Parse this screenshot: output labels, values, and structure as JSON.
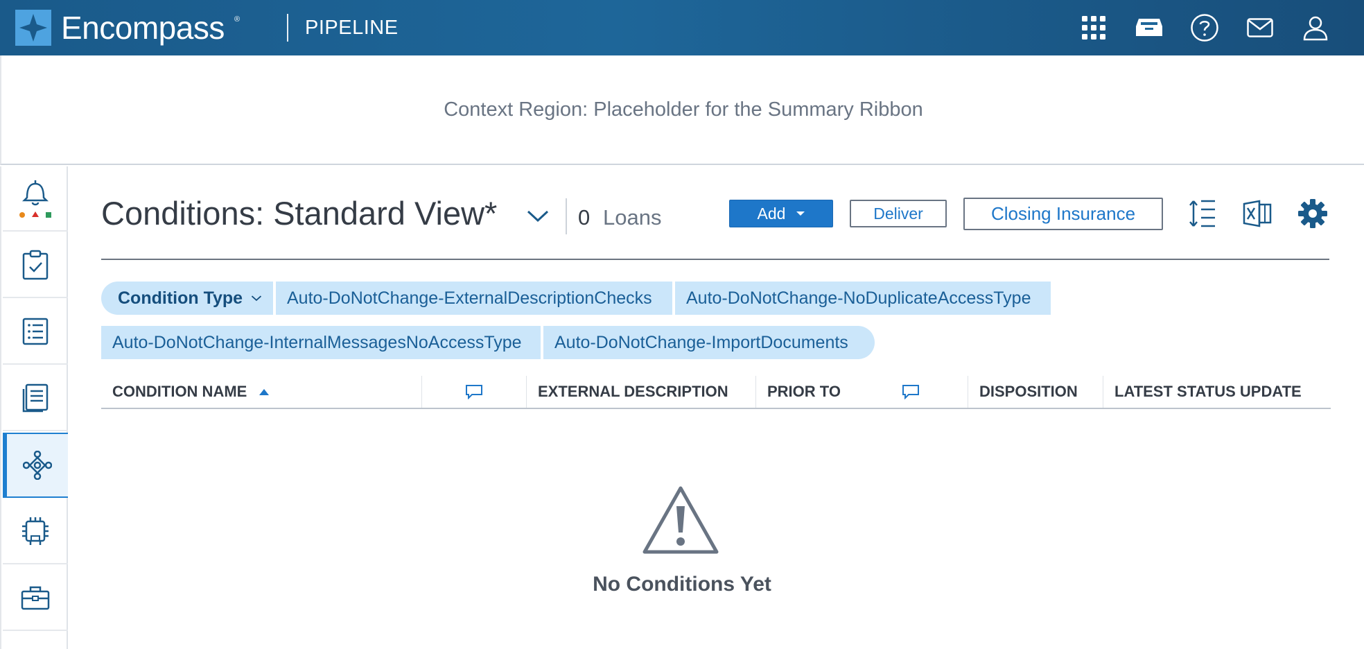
{
  "header": {
    "brand": "Encompass",
    "brand_mark": "®",
    "section": "PIPELINE",
    "icons": [
      "apps-grid-icon",
      "inbox-tray-icon",
      "help-icon",
      "mail-icon",
      "user-icon"
    ]
  },
  "context_region": {
    "text": "Context Region: Placeholder for the Summary Ribbon"
  },
  "left_nav": {
    "items": [
      "alerts-icon",
      "task-clipboard-icon",
      "list-icon",
      "documents-icon",
      "conditions-network-icon",
      "chip-icon",
      "briefcase-icon"
    ],
    "active": "conditions-network-icon"
  },
  "main": {
    "title": "Conditions: Standard View*",
    "loan_count": "0",
    "loan_label": "Loans",
    "buttons": {
      "add": "Add",
      "deliver": "Deliver",
      "closing_insurance": "Closing Insurance"
    },
    "tools": [
      "row-height-icon",
      "excel-export-icon",
      "settings-gear-icon"
    ]
  },
  "filters": {
    "type_label": "Condition Type",
    "pills": [
      "Auto-DoNotChange-ExternalDescriptionChecks",
      "Auto-DoNotChange-NoDuplicateAccessType",
      "Auto-DoNotChange-InternalMessagesNoAccessType",
      "Auto-DoNotChange-ImportDocuments"
    ]
  },
  "table": {
    "columns": {
      "condition_name": "CONDITION NAME",
      "external_description": "EXTERNAL DESCRIPTION",
      "prior_to": "PRIOR TO",
      "disposition": "DISPOSITION",
      "latest_status_update": "LATEST STATUS UPDATE"
    },
    "sort": "ascending"
  },
  "empty_state": {
    "text": "No Conditions Yet"
  },
  "colors": {
    "header_bg": "#1e6699",
    "accent": "#1e77c9",
    "pill_bg": "#cbe6fa",
    "active_nav_bg": "#e8f3fc"
  }
}
